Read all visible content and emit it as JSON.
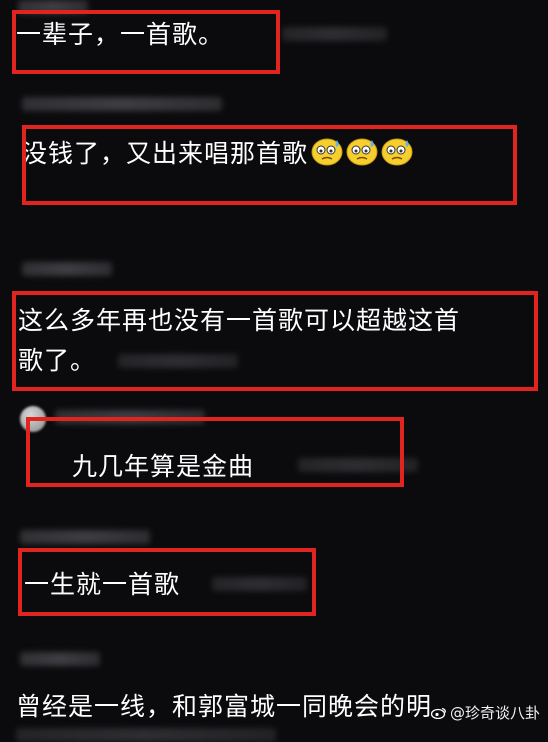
{
  "comments": [
    {
      "text": "一辈子，一首歌。"
    },
    {
      "text": "没钱了，又出来唱那首歌"
    },
    {
      "line1": "这么多年再也没有一首歌可以超越这首",
      "line2": "歌了。"
    },
    {
      "text": "九几年算是金曲"
    },
    {
      "text": "一生就一首歌"
    },
    {
      "text": "曾经是一线，和郭富城一同晚会的明"
    }
  ],
  "emoji_icons": [
    "sweat-thinking-emoji-icon",
    "sweat-thinking-emoji-icon",
    "sweat-thinking-emoji-icon"
  ],
  "watermark": {
    "text": "@珍奇谈八卦",
    "icon": "weibo-icon"
  },
  "colors": {
    "background": "#0b0b0d",
    "highlight_box": "#e0241f",
    "text": "#ffffff"
  }
}
